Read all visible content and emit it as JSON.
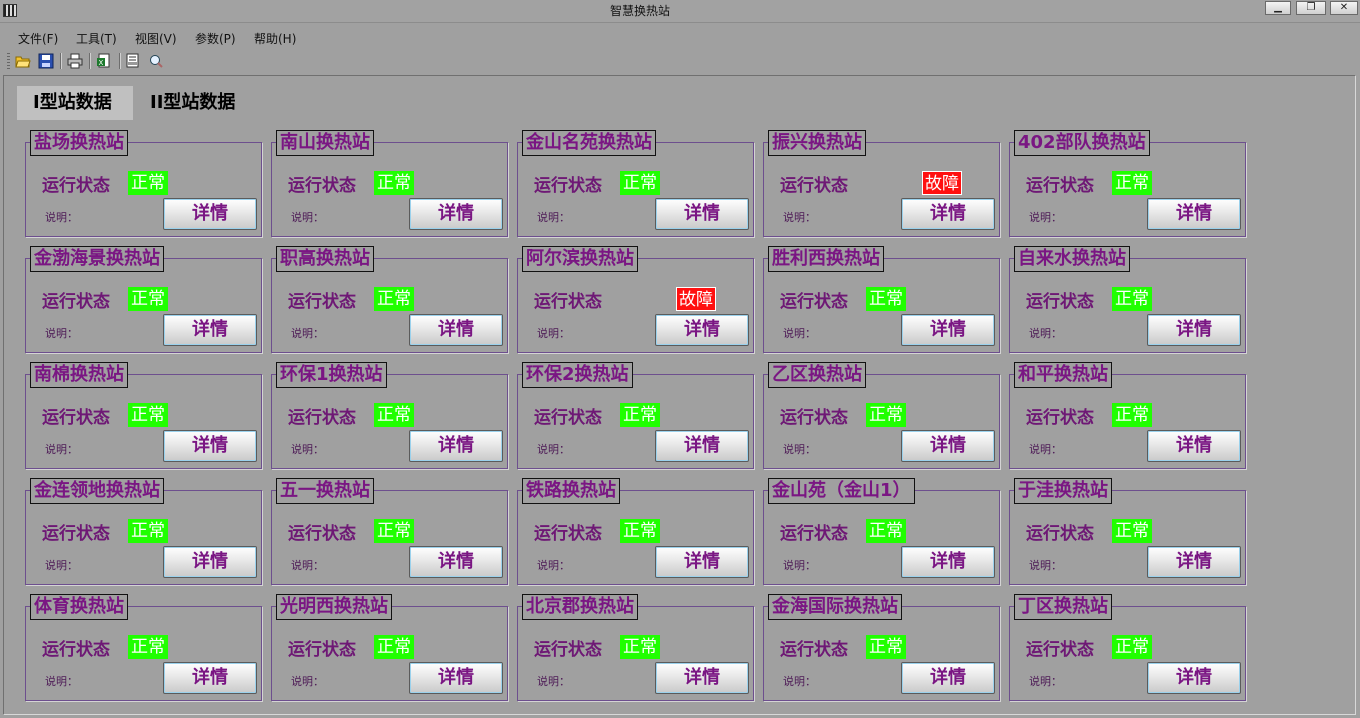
{
  "window": {
    "title": "智慧换热站"
  },
  "menu": [
    {
      "label": "文件(F)"
    },
    {
      "label": "工具(T)"
    },
    {
      "label": "视图(V)"
    },
    {
      "label": "参数(P)"
    },
    {
      "label": "帮助(H)"
    }
  ],
  "toolbar": {
    "icons": [
      "open-folder-icon",
      "save-icon",
      "print-icon",
      "export-icon",
      "print-preview-icon",
      "zoom-icon"
    ]
  },
  "tabs": [
    {
      "label": "I型站数据",
      "active": true
    },
    {
      "label": "II型站数据",
      "active": false
    }
  ],
  "labels": {
    "status": "运行状态",
    "note": "说明：",
    "detail": "详情"
  },
  "colors": {
    "ok": "#20ff00",
    "fault": "#ff1010",
    "title": "#7a1683"
  },
  "stations": [
    {
      "name": "盐场换热站",
      "status": "正常",
      "state": "ok"
    },
    {
      "name": "南山换热站",
      "status": "正常",
      "state": "ok"
    },
    {
      "name": "金山名苑换热站",
      "status": "正常",
      "state": "ok"
    },
    {
      "name": "振兴换热站",
      "status": "故障",
      "state": "fault"
    },
    {
      "name": "402部队换热站",
      "status": "正常",
      "state": "ok"
    },
    {
      "name": "金渤海景换热站",
      "status": "正常",
      "state": "ok"
    },
    {
      "name": "职高换热站",
      "status": "正常",
      "state": "ok"
    },
    {
      "name": "阿尔滨换热站",
      "status": "故障",
      "state": "fault"
    },
    {
      "name": "胜利西换热站",
      "status": "正常",
      "state": "ok"
    },
    {
      "name": "自来水换热站",
      "status": "正常",
      "state": "ok"
    },
    {
      "name": "南棉换热站",
      "status": "正常",
      "state": "ok"
    },
    {
      "name": "环保1换热站",
      "status": "正常",
      "state": "ok"
    },
    {
      "name": "环保2换热站",
      "status": "正常",
      "state": "ok"
    },
    {
      "name": "乙区换热站",
      "status": "正常",
      "state": "ok"
    },
    {
      "name": "和平换热站",
      "status": "正常",
      "state": "ok"
    },
    {
      "name": "金连领地换热站",
      "status": "正常",
      "state": "ok"
    },
    {
      "name": "五一换热站",
      "status": "正常",
      "state": "ok"
    },
    {
      "name": "铁路换热站",
      "status": "正常",
      "state": "ok"
    },
    {
      "name": "金山苑（金山1）",
      "status": "正常",
      "state": "ok"
    },
    {
      "name": "于洼换热站",
      "status": "正常",
      "state": "ok"
    },
    {
      "name": "体育换热站",
      "status": "正常",
      "state": "ok"
    },
    {
      "name": "光明西换热站",
      "status": "正常",
      "state": "ok"
    },
    {
      "name": "北京郡换热站",
      "status": "正常",
      "state": "ok"
    },
    {
      "name": "金海国际换热站",
      "status": "正常",
      "state": "ok"
    },
    {
      "name": "丁区换热站",
      "status": "正常",
      "state": "ok"
    }
  ]
}
